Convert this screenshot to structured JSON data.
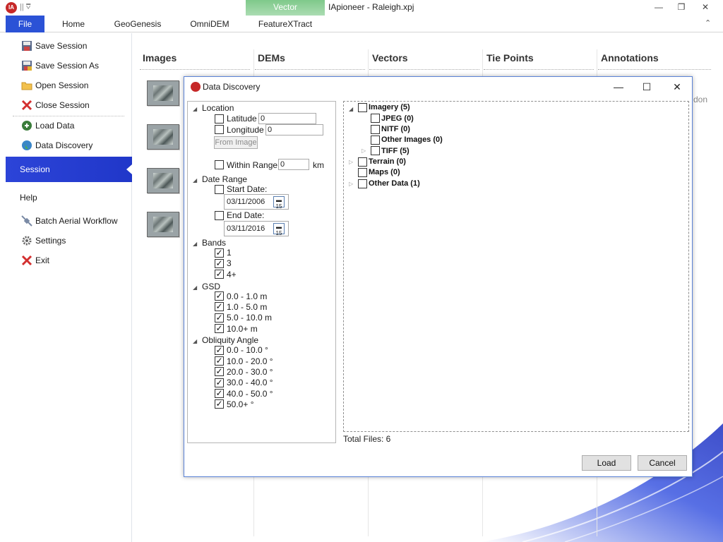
{
  "window": {
    "title": "IApioneer - Raleigh.xpj",
    "logo_text": "IA",
    "qat": "|| ⩢",
    "minimize": "—",
    "maximize": "❐",
    "close": "✕",
    "collapse": "⌃"
  },
  "ribbon": {
    "tabs": [
      "File",
      "Home",
      "GeoGenesis",
      "OmniDEM",
      "FeatureXTract"
    ],
    "contextual_group": "Vector",
    "accent": "#2b52d6",
    "contextual_color": "#7fc98a"
  },
  "backstage": {
    "items": [
      {
        "label": "Save Session",
        "icon": "save-icon"
      },
      {
        "label": "Save Session As",
        "icon": "save-as-icon"
      },
      {
        "label": "Open Session",
        "icon": "folder-icon"
      },
      {
        "label": "Close Session",
        "icon": "close-x-icon"
      },
      {
        "label": "Load Data",
        "icon": "load-data-icon"
      },
      {
        "label": "Data Discovery",
        "icon": "globe-icon"
      }
    ],
    "session": "Session",
    "help": "Help",
    "lower_items": [
      {
        "label": "Batch Aerial Workflow",
        "icon": "satellite-icon"
      },
      {
        "label": "Settings",
        "icon": "gear-icon"
      },
      {
        "label": "Exit",
        "icon": "exit-icon"
      }
    ]
  },
  "main": {
    "columns": [
      "Images",
      "DEMs",
      "Vectors",
      "Tie Points",
      "Annotations"
    ],
    "partial_text": "don"
  },
  "dialog": {
    "title": "Data Discovery",
    "minimize": "—",
    "maximize": "☐",
    "close": "✕",
    "filters": {
      "location": {
        "header": "Location",
        "latitude_label": "Latitude",
        "latitude_value": "0",
        "longitude_label": "Longitude",
        "longitude_value": "0",
        "from_image": "From Image",
        "within_range_label": "Within Range:",
        "within_range_value": "0",
        "range_unit": "km"
      },
      "date_range": {
        "header": "Date Range",
        "start_label": "Start Date:",
        "start_value": "03/11/2006",
        "end_label": "End Date:",
        "end_value": "03/11/2016",
        "calendar_day": "15"
      },
      "bands": {
        "header": "Bands",
        "items": [
          "1",
          "3",
          "4+"
        ]
      },
      "gsd": {
        "header": "GSD",
        "items": [
          "0.0 - 1.0 m",
          "1.0 - 5.0 m",
          "5.0 - 10.0 m",
          "10.0+ m"
        ]
      },
      "obliquity": {
        "header": "Obliquity Angle",
        "items": [
          "0.0 - 10.0 °",
          "10.0 - 20.0 °",
          "20.0 - 30.0 °",
          "30.0 - 40.0 °",
          "40.0 - 50.0 °",
          "50.0+ °"
        ]
      }
    },
    "tree": {
      "imagery": "Imagery (5)",
      "jpeg": "JPEG (0)",
      "nitf": "NITF (0)",
      "other_images": "Other Images (0)",
      "tiff": "TIFF (5)",
      "terrain": "Terrain (0)",
      "maps": "Maps (0)",
      "other_data": "Other Data (1)"
    },
    "total_files": "Total Files: 6",
    "load": "Load",
    "cancel": "Cancel"
  }
}
